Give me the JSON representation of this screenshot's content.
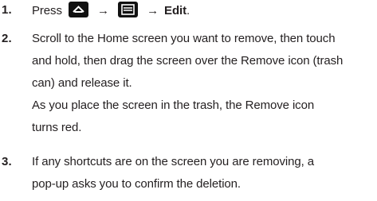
{
  "steps": [
    {
      "number": "1.",
      "press_text": "Press",
      "home_key_icon": "home-key-icon",
      "arrow1": "→",
      "menu_key_icon": "menu-key-icon",
      "arrow2": "→",
      "edit_label": "Edit",
      "period": "."
    },
    {
      "number": "2.",
      "lines": [
        "Scroll to the Home screen you want to remove, then touch",
        "and hold, then drag the screen over the Remove icon (trash",
        "can) and release it.",
        "As you place the screen in the trash, the Remove icon",
        "turns red."
      ]
    },
    {
      "number": "3.",
      "lines": [
        "If any shortcuts are on the screen you are removing, a",
        "pop-up asks you to confirm the deletion."
      ]
    }
  ]
}
